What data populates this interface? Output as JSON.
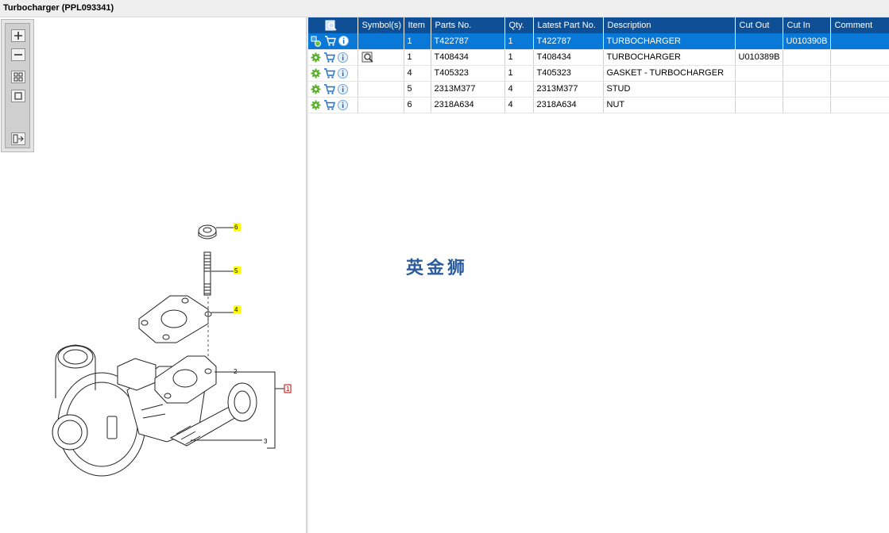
{
  "window": {
    "title": "Turbocharger (PPL093341)"
  },
  "toolbar": {
    "buttons": [
      {
        "name": "zoom-in",
        "icon": "zoom-in-icon"
      },
      {
        "name": "zoom-out",
        "icon": "zoom-out-icon"
      },
      {
        "name": "fit-all",
        "icon": "fit-all-icon"
      },
      {
        "name": "actual-size",
        "icon": "actual-size-icon"
      },
      {
        "name": "export",
        "icon": "export-icon"
      }
    ]
  },
  "diagram": {
    "callouts": [
      "6",
      "5",
      "4",
      "2",
      "1",
      "3"
    ],
    "highlight_color": "#ffff00",
    "selected_callout_color": "#d00000"
  },
  "table": {
    "columns": [
      "",
      "Symbol(s)",
      "Item",
      "Parts No.",
      "Qty.",
      "Latest Part No.",
      "Description",
      "Cut Out",
      "Cut In",
      "Comment"
    ],
    "rows": [
      {
        "selected": true,
        "item": "1",
        "part_no": "T422787",
        "qty": "1",
        "latest": "T422787",
        "description": "TURBOCHARGER",
        "cut_out": "",
        "cut_in": "U010390B",
        "comment": "",
        "symbol": ""
      },
      {
        "selected": false,
        "item": "1",
        "part_no": "T408434",
        "qty": "1",
        "latest": "T408434",
        "description": "TURBOCHARGER",
        "cut_out": "U010389B",
        "cut_in": "",
        "comment": "",
        "symbol": "magnifier-icon"
      },
      {
        "selected": false,
        "item": "4",
        "part_no": "T405323",
        "qty": "1",
        "latest": "T405323",
        "description": "GASKET - TURBOCHARGER",
        "cut_out": "",
        "cut_in": "",
        "comment": "",
        "symbol": ""
      },
      {
        "selected": false,
        "item": "5",
        "part_no": "2313M377",
        "qty": "4",
        "latest": "2313M377",
        "description": "STUD",
        "cut_out": "",
        "cut_in": "",
        "comment": "",
        "symbol": ""
      },
      {
        "selected": false,
        "item": "6",
        "part_no": "2318A634",
        "qty": "4",
        "latest": "2318A634",
        "description": "NUT",
        "cut_out": "",
        "cut_in": "",
        "comment": "",
        "symbol": ""
      }
    ],
    "header_color": "#0f4f95",
    "selected_color": "#0a78d7"
  },
  "watermark": {
    "text": "英金狮"
  }
}
